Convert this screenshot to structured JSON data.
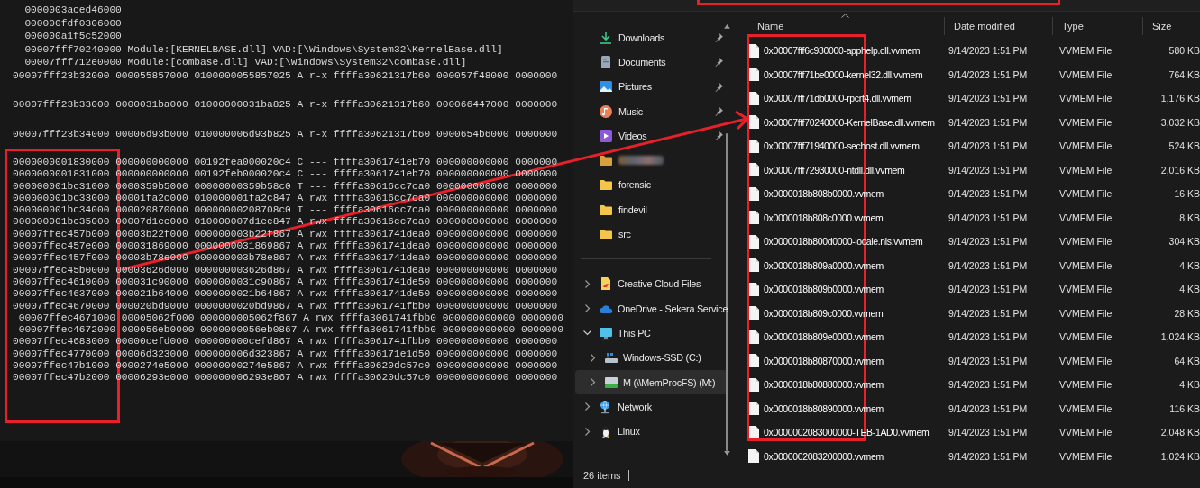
{
  "terminal": {
    "lines": [
      {
        "kind": "list",
        "text": "0000003aced46000"
      },
      {
        "kind": "list",
        "text": "000000fdf0306000"
      },
      {
        "kind": "list",
        "text": "000000a1f5c52000"
      },
      {
        "kind": "list",
        "text": "00007fff70240000 Module:[KERNELBASE.dll] VAD:[\\Windows\\System32\\KernelBase.dll]"
      },
      {
        "kind": "list",
        "text": "00007fff712e0000 Module:[combase.dll] VAD:[\\Windows\\System32\\combase.dll]"
      },
      {
        "kind": "entry",
        "spaced": true,
        "text": "00007fff23b32000 000055857000 0100000055857025 A r-x ffffa30621317b60 000057f48000 0000000"
      },
      {
        "kind": "entry",
        "spaced": true,
        "text": "00007fff23b33000 0000031ba000 01000000031ba825 A r-x ffffa30621317b60 000066447000 0000000"
      },
      {
        "kind": "entry",
        "spaced": true,
        "text": "00007fff23b34000 00006d93b000 010000006d93b825 A r-x ffffa30621317b60 0000654b6000 0000000"
      },
      {
        "kind": "entry",
        "text": "0000000001830000 000000000000 00192fea000020c4 C --- ffffa3061741eb70 000000000000 0000000"
      },
      {
        "kind": "entry",
        "text": "0000000001831000 000000000000 00192feb000020c4 C --- ffffa3061741eb70 000000000000 0000000"
      },
      {
        "kind": "entry",
        "text": "000000001bc31000 0000359b5000 00000000359b58c0 T --- ffffa30616cc7ca0 000000000000 0000000"
      },
      {
        "kind": "entry",
        "text": "000000001bc33000 00001fa2c000 010000001fa2c847 A rwx ffffa30616cc7ca0 000000000000 0000000"
      },
      {
        "kind": "entry",
        "text": "000000001bc34000 000020870000 00000000208708c0 T --- ffffa30616cc7ca0 000000000000 0000000"
      },
      {
        "kind": "entry",
        "text": "000000001bc35000 00007d1ee000 010000007d1ee847 A rwx ffffa30616cc7ca0 000000000000 0000000"
      },
      {
        "kind": "entry",
        "text": "00007ffec457b000 00003b22f000 000000003b22f867 A rwx ffffa3061741dea0 000000000000 0000000"
      },
      {
        "kind": "entry",
        "text": "00007ffec457e000 000031869000 0000000031869867 A rwx ffffa3061741dea0 000000000000 0000000"
      },
      {
        "kind": "entry",
        "text": "00007ffec457f000 00003b78e000 000000003b78e867 A rwx ffffa3061741dea0 000000000000 0000000"
      },
      {
        "kind": "entry",
        "text": "00007ffec45b0000 00003626d000 000000003626d867 A rwx ffffa3061741dea0 000000000000 0000000"
      },
      {
        "kind": "entry",
        "text": "00007ffec4610000 000031c90000 0000000031c90867 A rwx ffffa3061741de50 000000000000 0000000"
      },
      {
        "kind": "entry",
        "text": "00007ffec4637000 000021b64000 0000000021b64867 A rwx ffffa3061741de50 000000000000 0000000"
      },
      {
        "kind": "entry",
        "text": "00007ffec4670000 000020bd9000 0000000020bd9867 A rwx ffffa3061741fbb0 000000000000 0000000"
      },
      {
        "kind": "shifted",
        "text": "00007ffec4671000 00005062f000 000000005062f867 A rwx ffffa3061741fbb0 000000000000 0000000"
      },
      {
        "kind": "shifted",
        "text": "00007ffec4672000 000056eb0000 0000000056eb0867 A rwx ffffa3061741fbb0 000000000000 0000000"
      },
      {
        "kind": "entry",
        "text": "00007ffec4683000 00000cefd000 000000000cefd867 A rwx ffffa3061741fbb0 000000000000 0000000"
      },
      {
        "kind": "entry",
        "text": "00007ffec4770000 00006d323000 000000006d323867 A rwx ffffa306171e1d50 000000000000 0000000"
      },
      {
        "kind": "entry",
        "text": "00007ffec47b1000 0000274e5000 00000000274e5867 A rwx ffffa30620dc57c0 000000000000 0000000"
      },
      {
        "kind": "entry",
        "text": "00007ffec47b2000 00006293e000 000000006293e867 A rwx ffffa30620dc57c0 000000000000 0000000"
      }
    ]
  },
  "navigation": {
    "quick_access": [
      {
        "kind": "downloads",
        "label": "Downloads",
        "pinned": true
      },
      {
        "kind": "documents",
        "label": "Documents",
        "pinned": true
      },
      {
        "kind": "pictures",
        "label": "Pictures",
        "pinned": true
      },
      {
        "kind": "music",
        "label": "Music",
        "pinned": true
      },
      {
        "kind": "videos",
        "label": "Videos",
        "pinned": true
      },
      {
        "kind": "redacted",
        "pinned": false
      },
      {
        "kind": "folder",
        "label": "forensic",
        "pinned": false
      },
      {
        "kind": "folder",
        "label": "findevil",
        "pinned": false
      },
      {
        "kind": "folder",
        "label": "src",
        "pinned": false
      }
    ],
    "places": [
      {
        "kind": "cloud-files",
        "label": "Creative Cloud Files",
        "expanded": false,
        "selected": false
      },
      {
        "kind": "onedrive",
        "label": "OneDrive - Sekera Service",
        "expanded": false,
        "selected": false
      },
      {
        "kind": "pc",
        "label": "This PC",
        "expanded": true,
        "selected": false,
        "children": [
          {
            "kind": "drive",
            "label": "Windows-SSD (C:)",
            "expanded": false,
            "selected": false
          },
          {
            "kind": "network-drive",
            "label": "M (\\\\MemProcFS) (M:)",
            "expanded": false,
            "selected": true
          }
        ]
      },
      {
        "kind": "network",
        "label": "Network",
        "expanded": false,
        "selected": false
      },
      {
        "kind": "linux",
        "label": "Linux",
        "expanded": false,
        "selected": false
      }
    ]
  },
  "files": {
    "columns": [
      {
        "label": "Name",
        "sorted": true
      },
      {
        "label": "Date modified",
        "sorted": false
      },
      {
        "label": "Type",
        "sorted": false
      },
      {
        "label": "Size",
        "sorted": false
      }
    ],
    "rows": [
      {
        "name": "0x00007fff6c930000-apphelp.dll.vvmem",
        "date": "9/14/2023 1:51 PM",
        "type": "VVMEM File",
        "size": "580 KB"
      },
      {
        "name": "0x00007fff71be0000-kernel32.dll.vvmem",
        "date": "9/14/2023 1:51 PM",
        "type": "VVMEM File",
        "size": "764 KB"
      },
      {
        "name": "0x00007fff71db0000-rpcrt4.dll.vvmem",
        "date": "9/14/2023 1:51 PM",
        "type": "VVMEM File",
        "size": "1,176 KB"
      },
      {
        "name": "0x00007fff70240000-KernelBase.dll.vvmem",
        "date": "9/14/2023 1:51 PM",
        "type": "VVMEM File",
        "size": "3,032 KB"
      },
      {
        "name": "0x00007fff71940000-sechost.dll.vvmem",
        "date": "9/14/2023 1:51 PM",
        "type": "VVMEM File",
        "size": "524 KB"
      },
      {
        "name": "0x00007fff72930000-ntdll.dll.vvmem",
        "date": "9/14/2023 1:51 PM",
        "type": "VVMEM File",
        "size": "2,016 KB"
      },
      {
        "name": "0x0000018b808b0000.vvmem",
        "date": "9/14/2023 1:51 PM",
        "type": "VVMEM File",
        "size": "16 KB"
      },
      {
        "name": "0x0000018b808c0000.vvmem",
        "date": "9/14/2023 1:51 PM",
        "type": "VVMEM File",
        "size": "8 KB"
      },
      {
        "name": "0x0000018b800d0000-locale.nls.vvmem",
        "date": "9/14/2023 1:51 PM",
        "type": "VVMEM File",
        "size": "304 KB"
      },
      {
        "name": "0x0000018b809a0000.vvmem",
        "date": "9/14/2023 1:51 PM",
        "type": "VVMEM File",
        "size": "4 KB"
      },
      {
        "name": "0x0000018b809b0000.vvmem",
        "date": "9/14/2023 1:51 PM",
        "type": "VVMEM File",
        "size": "4 KB"
      },
      {
        "name": "0x0000018b809c0000.vvmem",
        "date": "9/14/2023 1:51 PM",
        "type": "VVMEM File",
        "size": "28 KB"
      },
      {
        "name": "0x0000018b809e0000.vvmem",
        "date": "9/14/2023 1:51 PM",
        "type": "VVMEM File",
        "size": "1,024 KB"
      },
      {
        "name": "0x0000018b80870000.vvmem",
        "date": "9/14/2023 1:51 PM",
        "type": "VVMEM File",
        "size": "64 KB"
      },
      {
        "name": "0x0000018b80880000.vvmem",
        "date": "9/14/2023 1:51 PM",
        "type": "VVMEM File",
        "size": "4 KB"
      },
      {
        "name": "0x0000018b80890000.vvmem",
        "date": "9/14/2023 1:51 PM",
        "type": "VVMEM File",
        "size": "116 KB"
      },
      {
        "name": "0x0000002083000000-TEB-1AD0.vvmem",
        "date": "9/14/2023 1:51 PM",
        "type": "VVMEM File",
        "size": "2,048 KB"
      },
      {
        "name": "0x0000002083200000.vvmem",
        "date": "9/14/2023 1:51 PM",
        "type": "VVMEM File",
        "size": "1,024 KB"
      }
    ]
  },
  "status_bar": {
    "count": "26 items"
  }
}
